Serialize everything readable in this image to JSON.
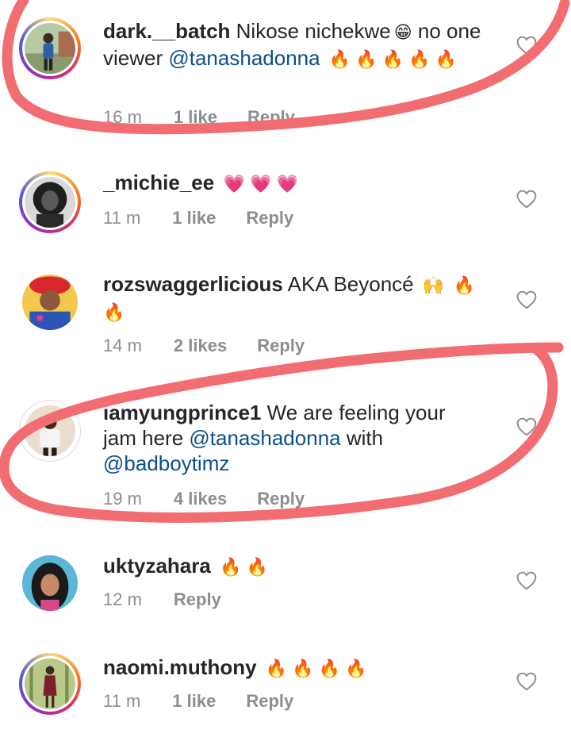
{
  "comments": [
    {
      "username": "dark.__batch",
      "text_parts": [
        "Nikose nichekwe",
        " no one viewer "
      ],
      "mention": "@tanashadonna",
      "emoji": "😁",
      "fires": "🔥 🔥 🔥 🔥 🔥",
      "time": "16 m",
      "likes": "1 like",
      "reply": "Reply"
    },
    {
      "username": "_michie_ee",
      "hearts": "💗 💗 💗",
      "time": "11 m",
      "likes": "1 like",
      "reply": "Reply"
    },
    {
      "username": "rozswaggerlicious",
      "text": "AKA Beyoncé",
      "emoji": "🙌",
      "fires": "🔥 🔥",
      "time": "14 m",
      "likes": "2 likes",
      "reply": "Reply"
    },
    {
      "username": "iamyungprince1",
      "text_a": "We are feeling your jam here",
      "mention_a": "@tanashadonna",
      "text_b": "with",
      "mention_b": "@badboytimz",
      "time": "19 m",
      "likes": "4 likes",
      "reply": "Reply"
    },
    {
      "username": "uktyzahara",
      "fires": "🔥 🔥",
      "time": "12 m",
      "reply": "Reply"
    },
    {
      "username": "naomi.muthony",
      "fires": "🔥 🔥 🔥 🔥",
      "time": "11 m",
      "likes": "1 like",
      "reply": "Reply"
    }
  ],
  "colors": {
    "mention": "#0d4f8b",
    "meta": "#8e8e8e",
    "highlight": "#f26d72"
  },
  "icons": {
    "like": "heart-outline-icon"
  }
}
